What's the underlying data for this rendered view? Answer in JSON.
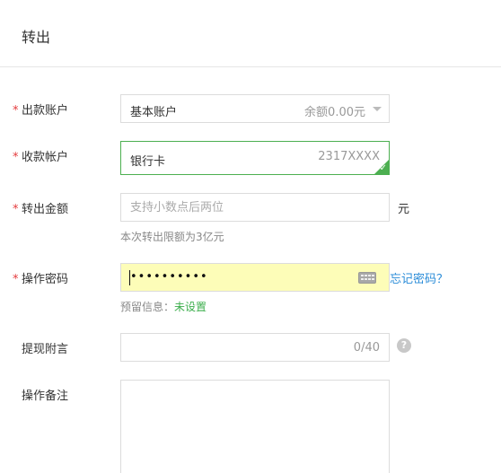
{
  "header": {
    "title": "转出"
  },
  "form": {
    "required_mark": "*",
    "debit_account": {
      "label": "出款账户",
      "value": "基本账户",
      "balance": "余额0.00元"
    },
    "credit_account": {
      "label": "收款帐户",
      "value": "银行卡",
      "card_number": "2317XXXX"
    },
    "amount": {
      "label": "转出金额",
      "placeholder": "支持小数点后两位",
      "unit": "元",
      "limit_hint": "本次转出限额为3亿元"
    },
    "password": {
      "label": "操作密码",
      "masked_value": "••••••••••",
      "forgot_link": "忘记密码？",
      "reserved_info_label": "预留信息：",
      "reserved_info_value": "未设置"
    },
    "withdraw_message": {
      "label": "提现附言",
      "counter": "0/40",
      "help_glyph": "?"
    },
    "remark": {
      "label": "操作备注"
    }
  },
  "colors": {
    "required": "#e4393c",
    "selected_border": "#4caf50",
    "link": "#2a8cd8",
    "password_bg": "#fdfdb8",
    "status_green": "#3cae4c"
  }
}
